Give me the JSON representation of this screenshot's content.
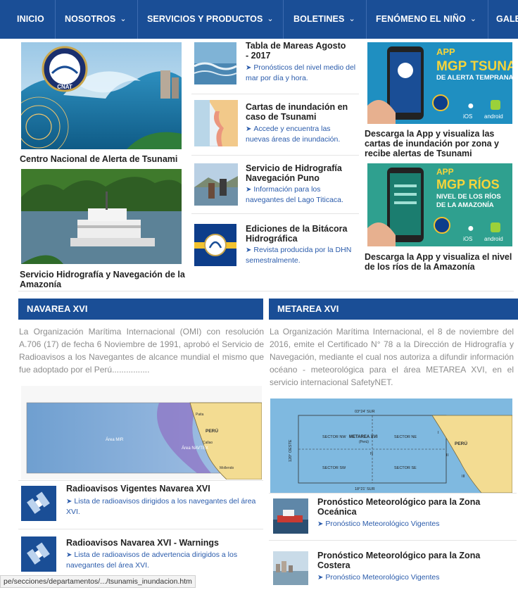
{
  "nav": {
    "items": [
      {
        "label": "INICIO",
        "has_dropdown": false
      },
      {
        "label": "NOSOTROS",
        "has_dropdown": true
      },
      {
        "label": "SERVICIOS Y PRODUCTOS",
        "has_dropdown": true
      },
      {
        "label": "BOLETINES",
        "has_dropdown": true
      },
      {
        "label": "FENÓMENO EL NIÑO",
        "has_dropdown": true
      },
      {
        "label": "GALE",
        "has_dropdown": false
      }
    ],
    "chevron": "⌄",
    "bg_color": "#1a4e96"
  },
  "col1": {
    "tsunami_center_caption": "Centro Nacional de Alerta de Tsunami",
    "tsunami_logo_text": "CNAT",
    "amazonia_caption": "Servicio Hidrografía y Navegación de la Amazonía"
  },
  "col2": {
    "cards": [
      {
        "title": "Tabla de Mareas Agosto - 2017",
        "desc": "Pronósticos del nivel medio del mar por día y hora."
      },
      {
        "title": "Cartas de inundación en caso de Tsunami",
        "desc": "Accede y encuentra las nuevas áreas de inundación."
      },
      {
        "title": "Servicio de Hidrografía Navegación Puno",
        "desc": "Información para los navegantes del Lago Titicaca."
      },
      {
        "title": "Ediciones de la Bitácora Hidrográfica",
        "desc": "Revista producida por la DHN semestralmente."
      }
    ]
  },
  "col3": {
    "app1": {
      "line1": "APP",
      "line2": "MGP TSUNAMI",
      "line3": "DE ALERTA TEMPRANA",
      "ios": "iOS",
      "android": "android",
      "caption": "Descarga la App y visualiza las cartas de inundación por zona y recibe alertas de Tsunami"
    },
    "app2": {
      "line1": "APP",
      "line2": "MGP RÍOS",
      "line3": "NIVEL DE LOS RÍOS",
      "line4": "DE LA AMAZONÍA",
      "ios": "iOS",
      "android": "android",
      "caption": "Descarga la App y visualiza el nivel de los ríos de la Amazonía"
    }
  },
  "navarea": {
    "heading": "NAVAREA XVI",
    "text": "La Organización Marítima Internacional (OMI) con resolución A.706 (17) de fecha 6 Noviembre de 1991, aprobó el Servicio de Radioavisos a los Navegantes de alcance mundial el mismo que fue adoptado por el Perú................",
    "map_labels": {
      "country": "PERÚ",
      "area": "Área MIR",
      "navtex": "Área NAVTEX",
      "paita": "Paita",
      "callao": "Callao",
      "mollendo": "Mollendo"
    },
    "items": [
      {
        "title": "Radioavisos Vigentes Navarea XVI",
        "desc": "Lista de radioavisos dirigidos a los navegantes del área XVI."
      },
      {
        "title": "Radioavisos Navarea XVI - Warnings",
        "desc": "Lista de radioavisos de advertencia dirigidos a los navegantes del área XVI."
      }
    ]
  },
  "metarea": {
    "heading": "METAREA XVI",
    "text": "La Organización Marítima Internacional, el 8 de noviembre del 2016, emite el Certificado N° 78 a la Dirección de Hidrografía y Navegación, mediante el cual nos autoriza a difundir información océano - meteorológica para el área METAREA XVI, en el servicio internacional SafetyNET.",
    "map_labels": {
      "title": "METAREA XVI",
      "sub": "(Perú)",
      "top": "03°24' SUR",
      "bottom": "18°21' SUR",
      "left": "120° OESTE",
      "nw": "SECTOR NW",
      "ne": "SECTOR NE",
      "sw": "SECTOR SW",
      "se": "SECTOR SE",
      "country": "PERÚ",
      "r1": "I",
      "r2": "II",
      "r3": "III",
      "n": "N"
    },
    "items": [
      {
        "title": "Pronóstico Meteorológico para la Zona Oceánica",
        "desc": "Pronóstico Meteorológico Vigentes"
      },
      {
        "title": "Pronóstico Meteorológico para la Zona Costera",
        "desc": "Pronóstico Meteorológico Vigentes"
      }
    ]
  },
  "status_bar": {
    "url": "pe/secciones/departamentos/.../tsunamis_inundacion.htm"
  }
}
